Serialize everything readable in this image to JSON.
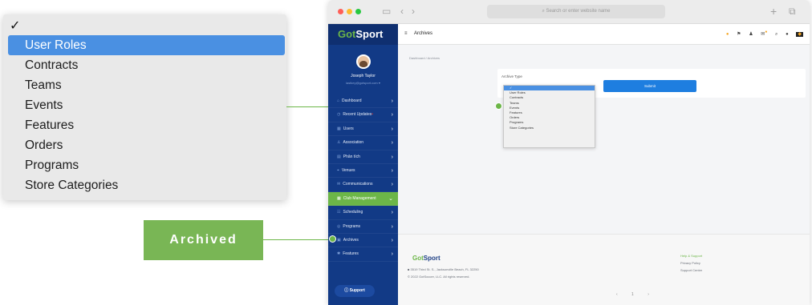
{
  "zoom_dropdown": {
    "checkmark": "✓",
    "options": [
      "User Roles",
      "Contracts",
      "Teams",
      "Events",
      "Features",
      "Orders",
      "Programs",
      "Store Categories"
    ],
    "selected_index": 0
  },
  "callout": {
    "label": "Archived"
  },
  "browser": {
    "address": "⌕ Search or enter website name"
  },
  "sidebar": {
    "logo_prefix": "Got",
    "logo_suffix": "Sport",
    "user_name": "Joseph Taylor",
    "user_email": "lastkey@gotsport.com ▾",
    "items": [
      {
        "label": "Dashboard",
        "icon": "⌂"
      },
      {
        "label": "Recent Updates",
        "icon": "◷"
      },
      {
        "label": "Users",
        "icon": "▦"
      },
      {
        "label": "Association",
        "icon": "♙"
      },
      {
        "label": "Phân tích",
        "icon": "▤"
      },
      {
        "label": "Venues",
        "icon": "⌖"
      },
      {
        "label": "Communications",
        "icon": "✉"
      },
      {
        "label": "Club Management",
        "icon": "▦"
      },
      {
        "label": "Scheduling",
        "icon": "☷"
      },
      {
        "label": "Programs",
        "icon": "◎"
      },
      {
        "label": "Archives",
        "icon": "▣"
      },
      {
        "label": "Features",
        "icon": "✱"
      }
    ],
    "active_index": 7,
    "support_label": "ⓘ Support"
  },
  "topbar": {
    "menu_icon": "≡",
    "title": "Archives"
  },
  "breadcrumb": "Dashboard  /  Archives",
  "form": {
    "archive_type_label": "Archive Type",
    "submit_label": "Submit",
    "options": [
      "✓",
      "User Roles",
      "Contracts",
      "Teams",
      "Events",
      "Features",
      "Orders",
      "Programs",
      "Store Categories"
    ]
  },
  "footer": {
    "logo_prefix": "Got",
    "logo_suffix": "Sport",
    "address": "■ 3519 Third St. S., Jacksonville Beach, FL 32250",
    "copyright": "© 2022 GotSoccer, LLC. All rights reserved.",
    "help": "Help & Support",
    "privacy": "Privacy Policy",
    "support_center": "Support Center",
    "pager": "‹ 1 ›"
  },
  "colors": {
    "accent_green": "#6cb648",
    "sidebar_blue": "#123a86",
    "select_blue": "#4a90e2",
    "submit_blue": "#1e7ee0"
  }
}
